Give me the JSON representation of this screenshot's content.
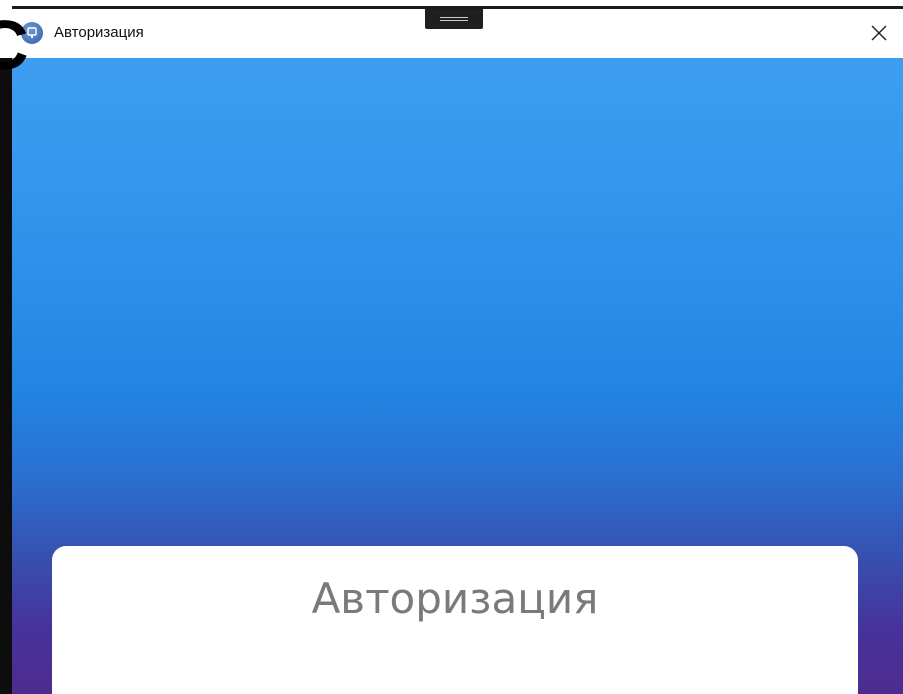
{
  "window": {
    "title": "Авторизация",
    "icon": "app-globe-icon",
    "close_icon": "close-icon"
  },
  "login_card": {
    "title": "Авторизация"
  },
  "stray_overlay_glyph": "C",
  "colors": {
    "gradient_top": "#3d9ef1",
    "gradient_mid": "#2285e2",
    "gradient_bottom": "#4e2c8f",
    "card_background": "#ffffff",
    "title_text": "#7a7a7a"
  }
}
